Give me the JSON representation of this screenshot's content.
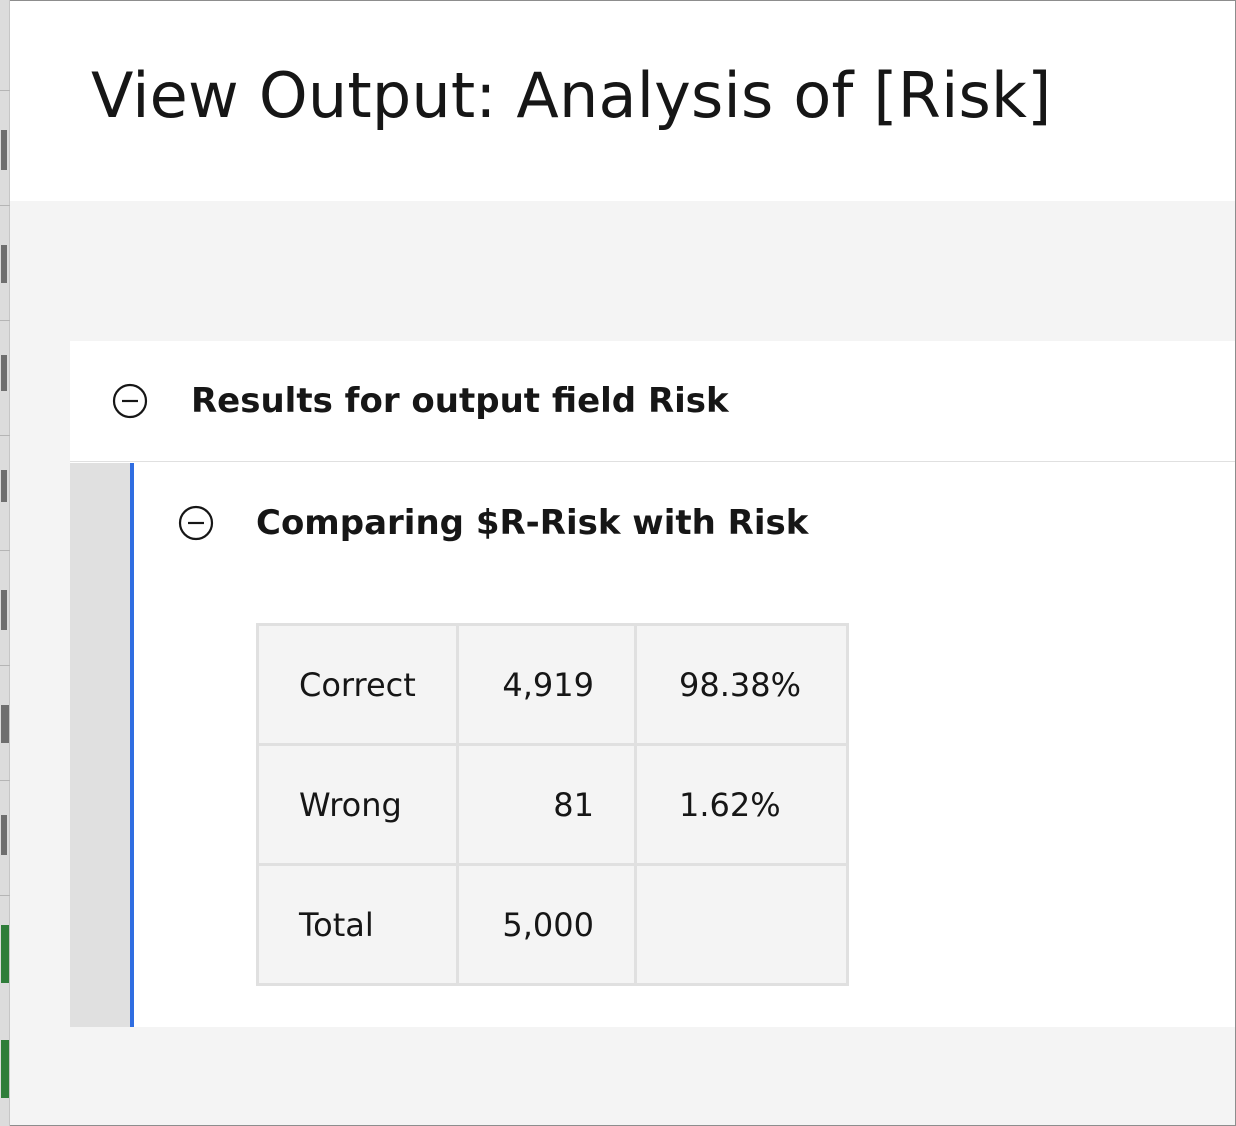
{
  "dialog": {
    "title": "View Output: Analysis of [Risk]"
  },
  "results": {
    "title": "Results for output field Risk",
    "collapse_icon": "collapse-minus-icon",
    "comparison": {
      "title": "Comparing $R-Risk with Risk",
      "collapse_icon": "collapse-minus-icon",
      "rows": [
        {
          "label": "Correct",
          "count": "4,919",
          "percent": "98.38%"
        },
        {
          "label": "Wrong",
          "count": "81",
          "percent": "1.62%"
        },
        {
          "label": "Total",
          "count": "5,000",
          "percent": ""
        }
      ]
    }
  },
  "colors": {
    "accent": "#2f6de1",
    "panel_bg": "#ffffff",
    "page_bg": "#f4f4f4",
    "table_bg": "#f4f4f4",
    "text": "#161616"
  }
}
